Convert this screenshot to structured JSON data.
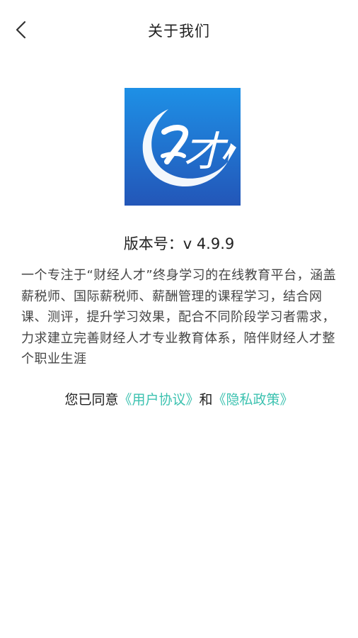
{
  "header": {
    "title": "关于我们"
  },
  "logo": {
    "glyph": "才",
    "colors": {
      "top": "#1e90e6",
      "bottom": "#2356b8",
      "swoosh": "#ffffff"
    }
  },
  "version": {
    "label": "版本号：",
    "value": "v 4.9.9"
  },
  "description": "一个专注于“财经人才”终身学习的在线教育平台，涵盖薪税师、国际薪税师、薪酬管理的课程学习，结合网课、测评，提升学习效果，配合不同阶段学习者需求，力求建立完善财经人才专业教育体系，陪伴财经人才整个职业生涯",
  "agreement": {
    "prefix": "您已同意",
    "user_agreement": "《用户协议》",
    "connector": "和",
    "privacy_policy": "《隐私政策》",
    "link_color": "#3cc2b0"
  }
}
